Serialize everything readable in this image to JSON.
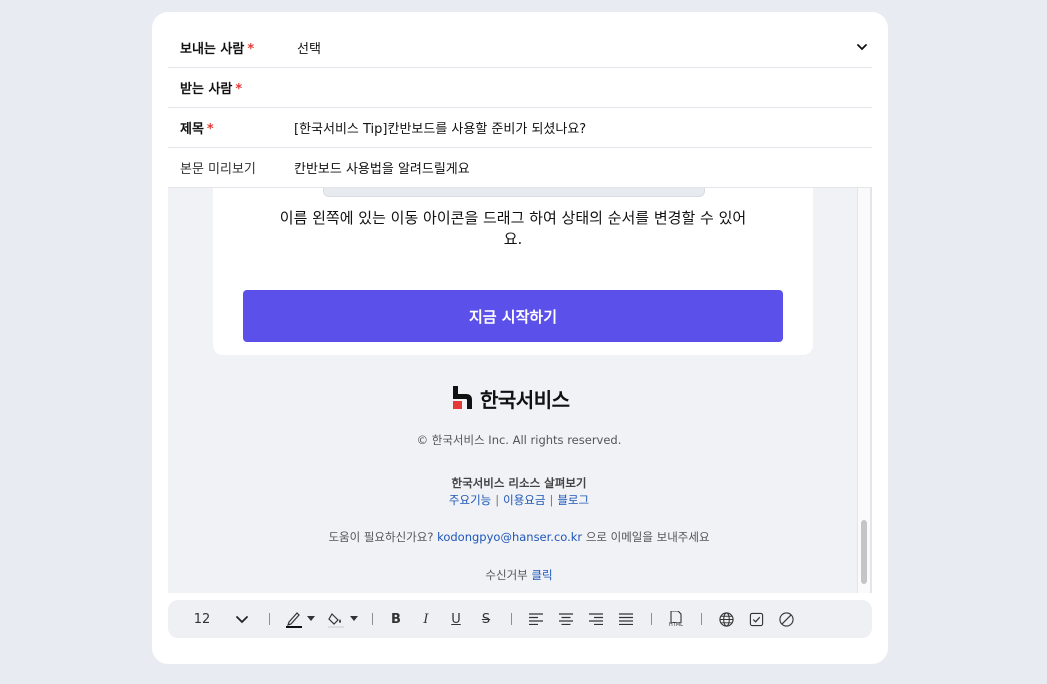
{
  "form": {
    "sender": {
      "label": "보내는 사람",
      "required": "*",
      "value": "선택"
    },
    "recipient": {
      "label": "받는 사람",
      "required": "*"
    },
    "subject": {
      "label": "제목",
      "required": "*",
      "value": "[한국서비스 Tip]칸반보드를 사용할 준비가 되셨나요?"
    },
    "preview_text": {
      "label": "본문 미리보기",
      "value": "칸반보드 사용법을 알려드릴게요"
    }
  },
  "email_body": {
    "description": "이름 왼쪽에 있는 이동 아이콘을 드래그 하여 상태의 순서를 변경할 수 있어요.",
    "cta_label": "지금 시작하기",
    "brand_name": "한국서비스",
    "copyright": "© 한국서비스 Inc. All rights reserved.",
    "resources_title": "한국서비스 리소스 살펴보기",
    "resource_links": [
      "주요기능",
      "이용요금",
      "블로그"
    ],
    "resource_separator": "|",
    "help_prefix": "도움이 필요하신가요?",
    "help_email": "kodongpyo@hanser.co.kr",
    "help_suffix": "으로 이메일을 보내주세요",
    "unsubscribe_label": "수신거부",
    "unsubscribe_link": "클릭"
  },
  "toolbar": {
    "font_size": "12",
    "icons": [
      "chevron-down-icon",
      "pen-color-icon",
      "fill-color-icon",
      "bold-icon",
      "italic-icon",
      "underline-icon",
      "strikethrough-icon",
      "align-left-icon",
      "align-center-icon",
      "align-right-icon",
      "justify-icon",
      "html-icon",
      "globe-icon",
      "checkbox-icon",
      "block-icon"
    ],
    "bold_glyph": "B",
    "italic_glyph": "I",
    "underline_glyph": "U",
    "strike_glyph": "S",
    "html_glyph": "HTML"
  },
  "colors": {
    "accent": "#5b50ea",
    "required": "#e53935",
    "link": "#1d56b8",
    "logo_red": "#e53935"
  }
}
